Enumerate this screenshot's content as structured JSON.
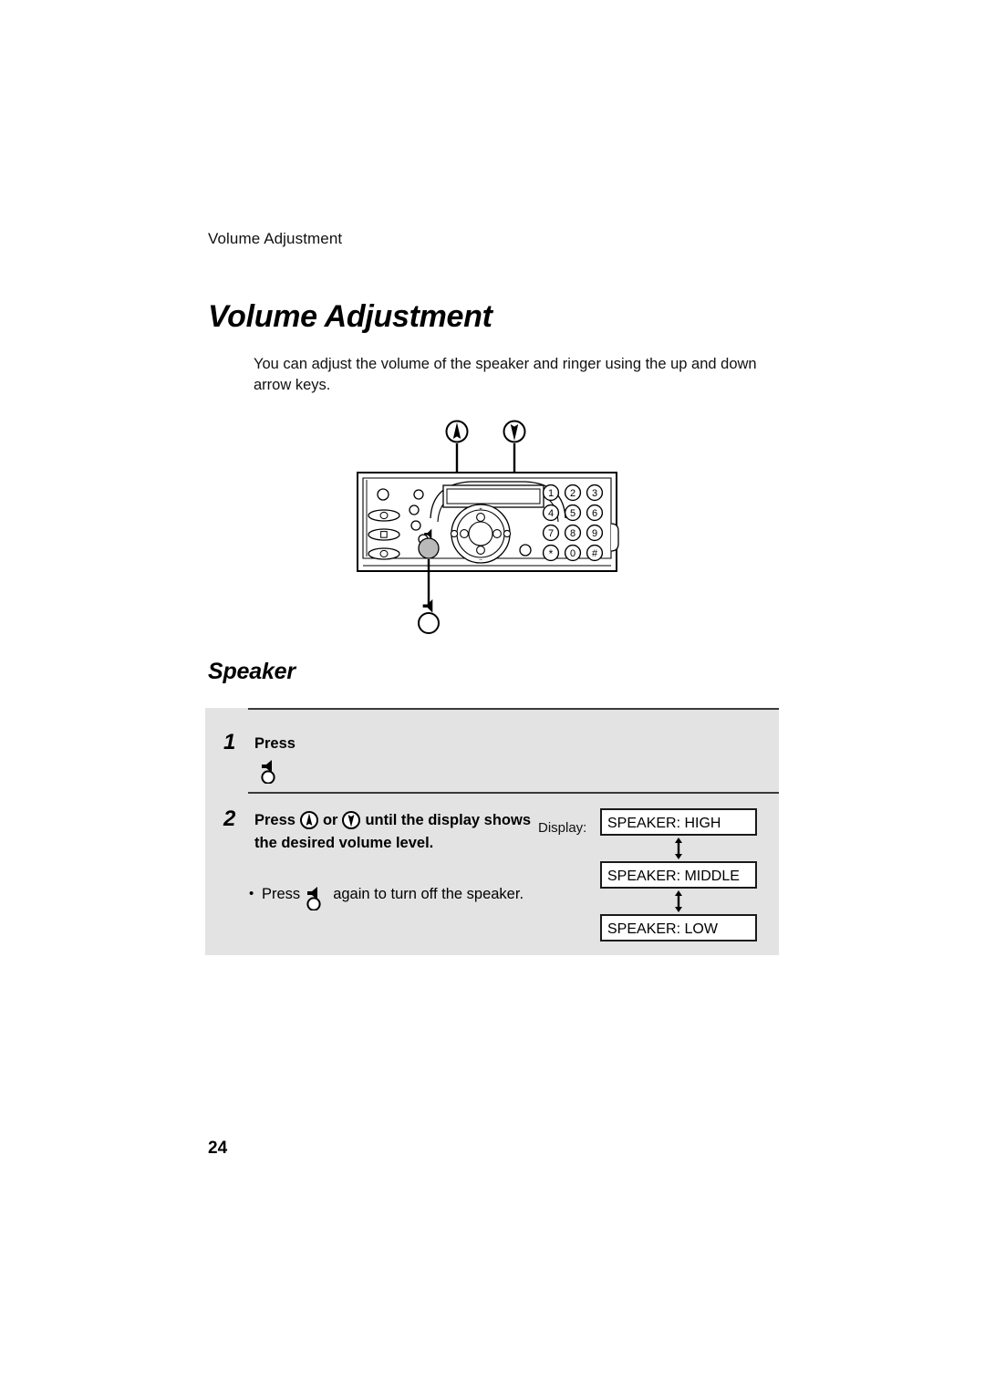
{
  "page": {
    "running_header": "Volume Adjustment",
    "title": "Volume Adjustment",
    "intro": "You can adjust the volume of the speaker and ringer using the up and down arrow keys.",
    "page_number": "24"
  },
  "figure": {
    "callout_up_icon": "up-arrow-key-icon",
    "callout_down_icon": "down-arrow-key-icon",
    "callout_speaker_icon": "speaker-key-icon",
    "keypad": [
      "1",
      "2",
      "3",
      "4",
      "5",
      "6",
      "7",
      "8",
      "9",
      "*",
      "0",
      "#"
    ]
  },
  "section": {
    "title": "Speaker",
    "steps": [
      {
        "number": "1",
        "text_before": "Press",
        "icon": "speaker-key-icon",
        "text_after": ""
      },
      {
        "number": "2",
        "text_before": "Press",
        "icon_a": "up-arrow-key-icon",
        "conjunction": "or",
        "icon_b": "down-arrow-key-icon",
        "text_after": "until the display shows the desired volume level.",
        "bullet": {
          "marker": "•",
          "text_before": "Press",
          "icon": "speaker-key-icon",
          "text_after": "again to turn off the speaker."
        }
      }
    ],
    "display_flow": {
      "label": "Display:",
      "boxes": [
        "SPEAKER: HIGH",
        "SPEAKER: MIDDLE",
        "SPEAKER: LOW"
      ],
      "connector": "double-headed-vertical-arrow"
    }
  },
  "colors": {
    "panel_gray": "#e3e3e3",
    "rule": "#3a3a3a",
    "ink": "#000000",
    "box_border": "#1a1a1a"
  }
}
